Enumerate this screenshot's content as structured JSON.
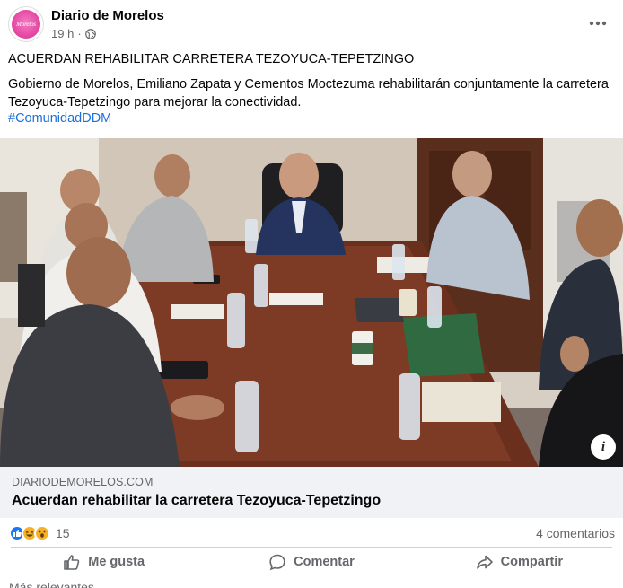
{
  "post": {
    "page_name": "Diario de Morelos",
    "avatar_text": "Morelos",
    "timestamp": "19 h",
    "separator": "·",
    "headline": "ACUERDAN REHABILITAR CARRETERA TEZOYUCA-TEPETZINGO",
    "body": "Gobierno de Morelos, Emiliano Zapata y Cementos Moctezuma rehabilitarán conjuntamente la carretera Tezoyuca-Tepetzingo para mejorar la conectividad.",
    "hashtag": "#ComunidadDDM"
  },
  "link_preview": {
    "domain": "DIARIODEMORELOS.COM",
    "title": "Acuerdan rehabilitar la carretera Tezoyuca-Tepetzingo",
    "info_label": "i"
  },
  "stats": {
    "reaction_count": "15",
    "comments": "4 comentarios"
  },
  "actions": {
    "like": "Me gusta",
    "comment": "Comentar",
    "share": "Compartir"
  },
  "footer_partial": "Más relevantes",
  "colors": {
    "link_blue": "#216fdb",
    "secondary_text": "#65676b",
    "like_blue": "#1877f2",
    "haha_yellow": "#f7b125"
  }
}
